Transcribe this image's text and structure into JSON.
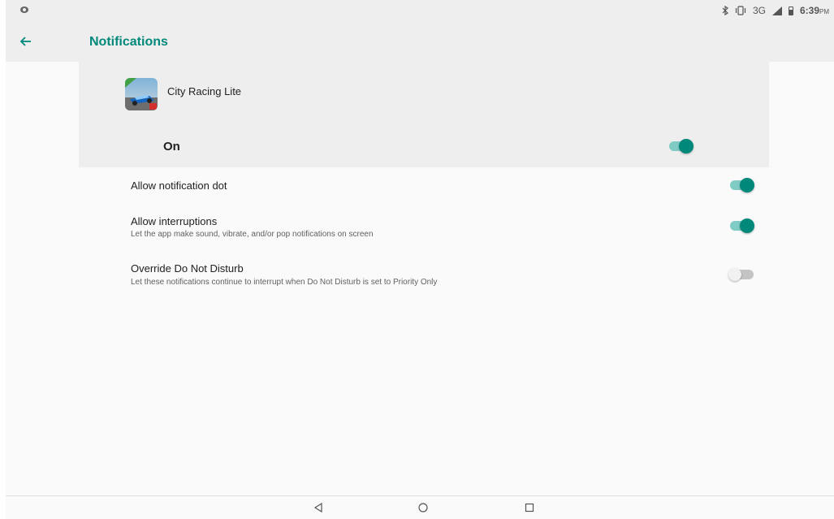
{
  "status_bar": {
    "network": "3G",
    "network_sup": "3G",
    "time": "6:39",
    "time_period": "PM"
  },
  "app_bar": {
    "title": "Notifications"
  },
  "app": {
    "name": "City Racing Lite",
    "icon": "city-racing-app-icon"
  },
  "master_toggle": {
    "label": "On",
    "state": true
  },
  "settings": [
    {
      "title": "Allow notification dot",
      "summary": "",
      "state": true
    },
    {
      "title": "Allow interruptions",
      "summary": "Let the app make sound, vibrate, and/or pop notifications on screen",
      "state": true
    },
    {
      "title": "Override Do Not Disturb",
      "summary": "Let these notifications continue to interrupt when Do Not Disturb is set to Priority Only",
      "state": false
    }
  ],
  "nav_bar": {
    "icons": [
      "back-triangle-icon",
      "home-circle-icon",
      "recents-square-icon"
    ]
  },
  "colors": {
    "accent": "#00897b",
    "accent_track": "#80cbc4",
    "background": "#fafafa",
    "header_background": "#eeeeee"
  }
}
